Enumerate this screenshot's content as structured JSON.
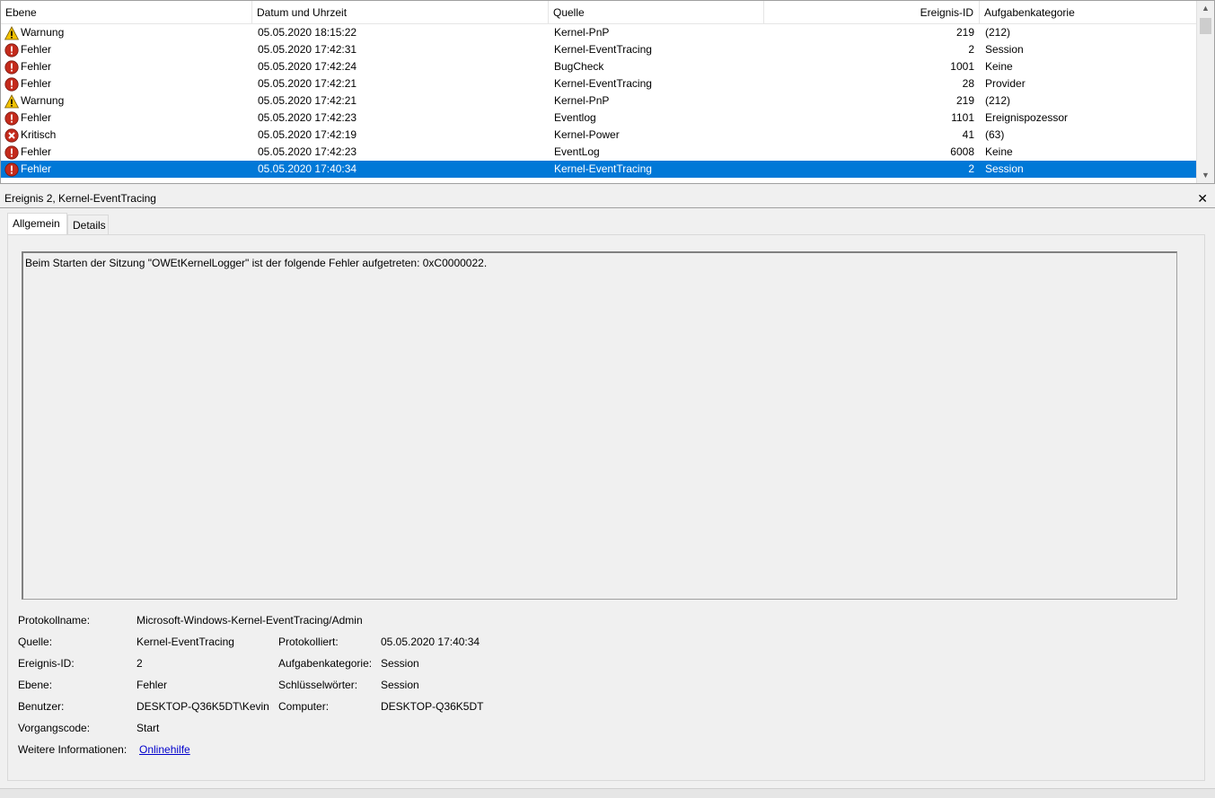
{
  "list": {
    "columns": {
      "level": "Ebene",
      "date": "Datum und Uhrzeit",
      "source": "Quelle",
      "event_id": "Ereignis-ID",
      "category": "Aufgabenkategorie"
    },
    "rows": [
      {
        "level": "Warnung",
        "icon": "warning-icon",
        "date": "05.05.2020 18:15:22",
        "source": "Kernel-PnP",
        "id": "219",
        "category": "(212)"
      },
      {
        "level": "Fehler",
        "icon": "error-icon",
        "date": "05.05.2020 17:42:31",
        "source": "Kernel-EventTracing",
        "id": "2",
        "category": "Session"
      },
      {
        "level": "Fehler",
        "icon": "error-icon",
        "date": "05.05.2020 17:42:24",
        "source": "BugCheck",
        "id": "1001",
        "category": "Keine"
      },
      {
        "level": "Fehler",
        "icon": "error-icon",
        "date": "05.05.2020 17:42:21",
        "source": "Kernel-EventTracing",
        "id": "28",
        "category": "Provider"
      },
      {
        "level": "Warnung",
        "icon": "warning-icon",
        "date": "05.05.2020 17:42:21",
        "source": "Kernel-PnP",
        "id": "219",
        "category": "(212)"
      },
      {
        "level": "Fehler",
        "icon": "error-icon",
        "date": "05.05.2020 17:42:23",
        "source": "Eventlog",
        "id": "1101",
        "category": "Ereignispozessor"
      },
      {
        "level": "Kritisch",
        "icon": "critical-icon",
        "date": "05.05.2020 17:42:19",
        "source": "Kernel-Power",
        "id": "41",
        "category": "(63)"
      },
      {
        "level": "Fehler",
        "icon": "error-icon",
        "date": "05.05.2020 17:42:23",
        "source": "EventLog",
        "id": "6008",
        "category": "Keine"
      },
      {
        "level": "Fehler",
        "icon": "error-icon",
        "date": "05.05.2020 17:40:34",
        "source": "Kernel-EventTracing",
        "id": "2",
        "category": "Session",
        "selected": true
      }
    ]
  },
  "detail": {
    "title": "Ereignis 2, Kernel-EventTracing",
    "close_glyph": "✕",
    "tabs": [
      "Allgemein",
      "Details"
    ],
    "active_tab": "Allgemein",
    "message": "Beim Starten der Sitzung \"OWEtKernelLogger\" ist der folgende Fehler aufgetreten: 0xC0000022.",
    "properties": {
      "log_name_label": "Protokollname:",
      "log_name": "Microsoft-Windows-Kernel-EventTracing/Admin",
      "source_label": "Quelle:",
      "source": "Kernel-EventTracing",
      "logged_label": "Protokolliert:",
      "logged": "05.05.2020 17:40:34",
      "event_id_label": "Ereignis-ID:",
      "event_id": "2",
      "task_category_label": "Aufgabenkategorie:",
      "task_category": "Session",
      "level_label": "Ebene:",
      "level": "Fehler",
      "keywords_label": "Schlüsselwörter:",
      "keywords": "Session",
      "user_label": "Benutzer:",
      "user": "DESKTOP-Q36K5DT\\Kevin",
      "computer_label": "Computer:",
      "computer": "DESKTOP-Q36K5DT",
      "opcode_label": "Vorgangscode:",
      "opcode": "Start",
      "more_info_label": "Weitere Informationen:",
      "more_info_link": "Onlinehilfe"
    }
  },
  "colors": {
    "selection": "#0078d7",
    "error": "#c42b1c",
    "warning": "#f2c200",
    "critical": "#c42b1c",
    "link": "#0000cc"
  }
}
